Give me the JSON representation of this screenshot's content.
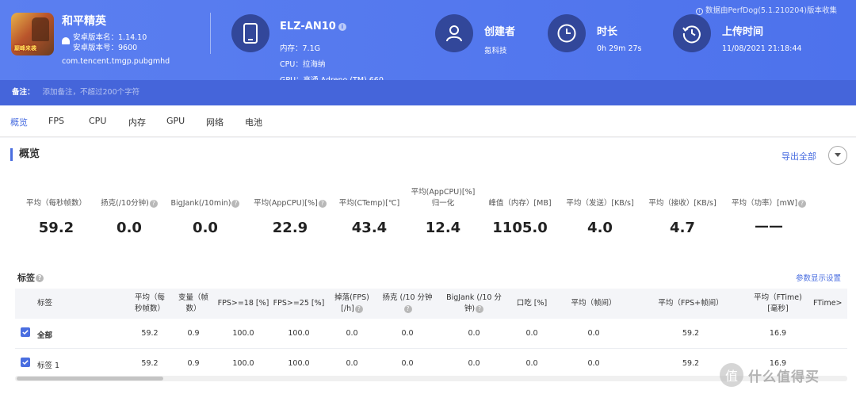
{
  "header": {
    "app": {
      "name": "和平精英",
      "version_name": "安卓版本名：1.14.10",
      "version_code": "安卓版本号：9600",
      "package": "com.tencent.tmgp.pubgmhd",
      "icon_badge": "巅峰来袭"
    },
    "device": {
      "name": "ELZ-AN10",
      "memory": "内存：7.1G",
      "cpu": "CPU：拉海纳",
      "gpu": "GPU：高通 Adreno (TM) 660"
    },
    "creator": {
      "title": "创建者",
      "value": "氪科技"
    },
    "duration": {
      "title": "时长",
      "value": "0h 29m 27s"
    },
    "upload": {
      "title": "上传时间",
      "value": "11/08/2021 21:18:44"
    },
    "data_note": "数据由PerfDog(5.1.210204)版本收集"
  },
  "remark": {
    "label": "备注：",
    "placeholder": "添加备注，不超过200个字符"
  },
  "tabs": [
    "概览",
    "FPS",
    "CPU",
    "内存",
    "GPU",
    "网络",
    "电池"
  ],
  "overview": {
    "title": "概览",
    "export_label": "导出全部",
    "stats": [
      {
        "label": "平均（每秒帧数）",
        "value": "59.2"
      },
      {
        "label": "扬克(/10分钟)",
        "value": "0.0"
      },
      {
        "label": "BigJank(/10min)",
        "value": "0.0"
      },
      {
        "label": "平均(AppCPU)[%]",
        "value": "22.9"
      },
      {
        "label": "平均(CTemp)[℃]",
        "value": "43.4"
      },
      {
        "label": "平均(AppCPU)[%]",
        "label2": "归一化",
        "value": "12.4"
      },
      {
        "label": "峰值（内存）[MB]",
        "value": "1105.0"
      },
      {
        "label": "平均（发送）[KB/s]",
        "value": "4.0"
      },
      {
        "label": "平均（接收）[KB/s]",
        "value": "4.7"
      },
      {
        "label": "平均（功率）[mW]",
        "value": "——"
      }
    ]
  },
  "tags": {
    "title": "标签",
    "param_settings": "参数显示设置",
    "columns": [
      {
        "l1": "标签",
        "l2": ""
      },
      {
        "l1": "平均（每",
        "l2": "秒帧数）"
      },
      {
        "l1": "变量（帧",
        "l2": "数）"
      },
      {
        "l1": "FPS>=18 [%]",
        "l2": ""
      },
      {
        "l1": "FPS>=25 [%]",
        "l2": ""
      },
      {
        "l1": "掉落(FPS)",
        "l2": "[/h]"
      },
      {
        "l1": "扬克 (/10 分钟",
        "l2": ")"
      },
      {
        "l1": "BigJank (/10 分",
        "l2": "钟)"
      },
      {
        "l1": "口吃 [%]",
        "l2": ""
      },
      {
        "l1": "平均（帧间）",
        "l2": ""
      },
      {
        "l1": "平均（FPS+帧间）",
        "l2": ""
      },
      {
        "l1": "平均（FTime)",
        "l2": "[毫秒]"
      },
      {
        "l1": "FTime>",
        "l2": ""
      }
    ],
    "rows": [
      {
        "name": "全部",
        "cells": [
          "59.2",
          "0.9",
          "100.0",
          "100.0",
          "0.0",
          "0.0",
          "0.0",
          "0.0",
          "0.0",
          "59.2",
          "16.9"
        ]
      },
      {
        "name": "标签 1",
        "cells": [
          "59.2",
          "0.9",
          "100.0",
          "100.0",
          "0.0",
          "0.0",
          "0.0",
          "0.0",
          "0.0",
          "59.2",
          "16.9"
        ]
      }
    ]
  },
  "watermark": {
    "text": "什么值得买",
    "logo": "值"
  },
  "colors": {
    "header_bg": "#4d72ec",
    "accent": "#4a6ee0",
    "icon_circle": "#32479a"
  }
}
